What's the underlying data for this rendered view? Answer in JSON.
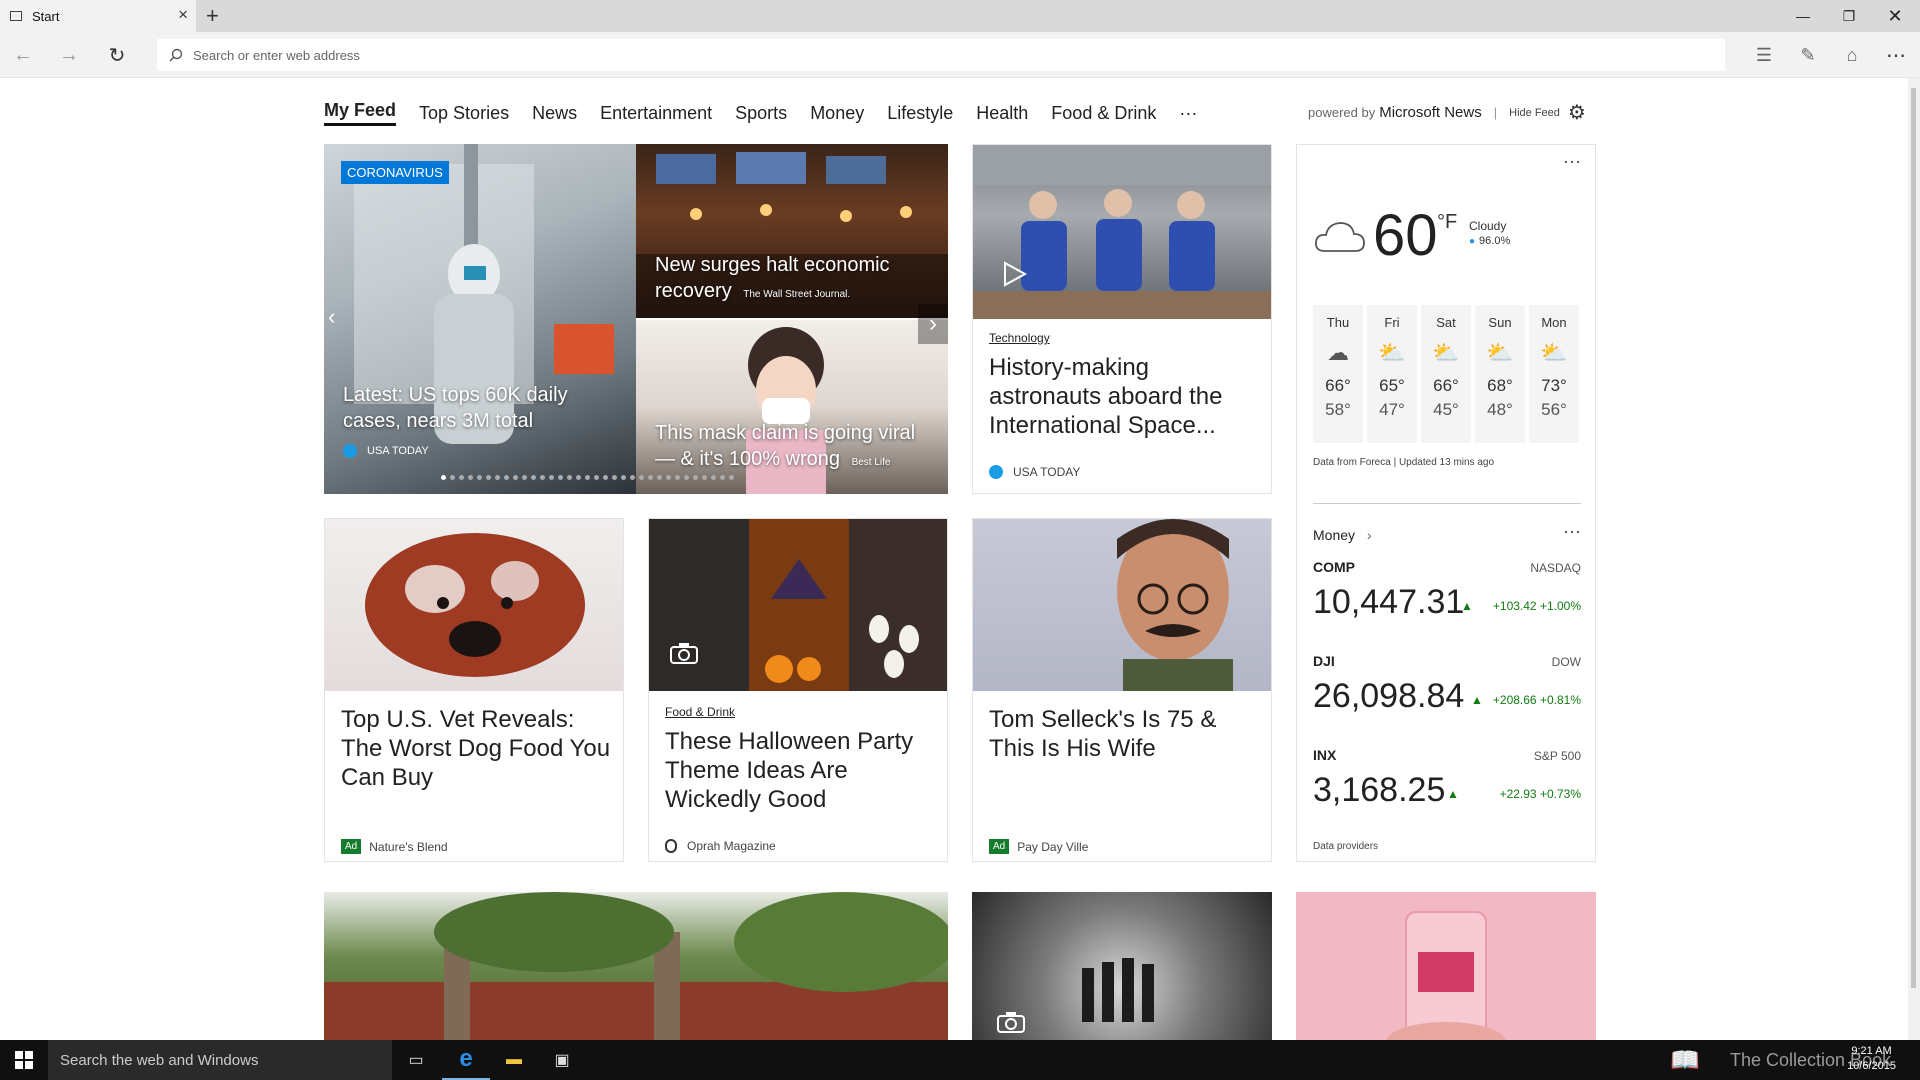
{
  "browser": {
    "tab_title": "Start",
    "address_placeholder": "Search or enter web address"
  },
  "feed_nav": {
    "categories": [
      "My Feed",
      "Top Stories",
      "News",
      "Entertainment",
      "Sports",
      "Money",
      "Lifestyle",
      "Health",
      "Food & Drink",
      "···"
    ],
    "powered_prefix": "powered by",
    "powered_brand": "Microsoft News",
    "hide_feed": "Hide Feed"
  },
  "hero": {
    "tag": "CORONAVIRUS",
    "main_headline": "Latest: US tops 60K daily cases, nears 3M total",
    "main_source": "USA TODAY",
    "story2_headline": "New surges halt economic recovery",
    "story2_source": "The Wall Street Journal.",
    "story3_headline": "This mask claim is going viral — & it's 100% wrong",
    "story3_source": "Best Life"
  },
  "card_astronauts": {
    "category": "Technology",
    "headline": "History-making astronauts aboard the International Space...",
    "source": "USA TODAY"
  },
  "card_dog": {
    "headline": "Top U.S. Vet Reveals: The Worst Dog Food You Can Buy",
    "ad": "Ad",
    "source": "Nature's Blend"
  },
  "card_halloween": {
    "category": "Food & Drink",
    "headline": "These Halloween Party Theme Ideas Are Wickedly Good",
    "source": "Oprah Magazine"
  },
  "card_selleck": {
    "headline": "Tom Selleck's Is 75 & This Is His Wife",
    "ad": "Ad",
    "source": "Pay Day Ville"
  },
  "weather": {
    "temp": "60",
    "unit": "°F",
    "condition": "Cloudy",
    "humidity": "96.0%",
    "days": [
      {
        "name": "Thu",
        "hi": "66°",
        "lo": "58°",
        "icon": "rain-cloud-icon"
      },
      {
        "name": "Fri",
        "hi": "65°",
        "lo": "47°",
        "icon": "sun-rain-icon"
      },
      {
        "name": "Sat",
        "hi": "66°",
        "lo": "45°",
        "icon": "sun-rain-icon"
      },
      {
        "name": "Sun",
        "hi": "68°",
        "lo": "48°",
        "icon": "partly-sunny-icon"
      },
      {
        "name": "Mon",
        "hi": "73°",
        "lo": "56°",
        "icon": "partly-sunny-icon"
      }
    ],
    "footer": "Data from Foreca | Updated 13 mins ago"
  },
  "money": {
    "title": "Money",
    "stocks": [
      {
        "symbol": "COMP",
        "exchange": "NASDAQ",
        "value": "10,447.31",
        "change": "+103.42",
        "pct": "+1.00%"
      },
      {
        "symbol": "DJI",
        "exchange": "DOW",
        "value": "26,098.84",
        "change": "+208.66",
        "pct": "+0.81%"
      },
      {
        "symbol": "INX",
        "exchange": "S&P 500",
        "value": "3,168.25",
        "change": "+22.93",
        "pct": "+0.73%"
      }
    ],
    "footer": "Data providers"
  },
  "taskbar": {
    "search_placeholder": "Search the web and Windows",
    "time": "9:21 AM",
    "date": "10/6/2015",
    "watermark": "The Collection Book"
  },
  "colors": {
    "accent_blue": "#0078d7",
    "stock_green": "#107c10",
    "ad_green": "#157c2b"
  }
}
